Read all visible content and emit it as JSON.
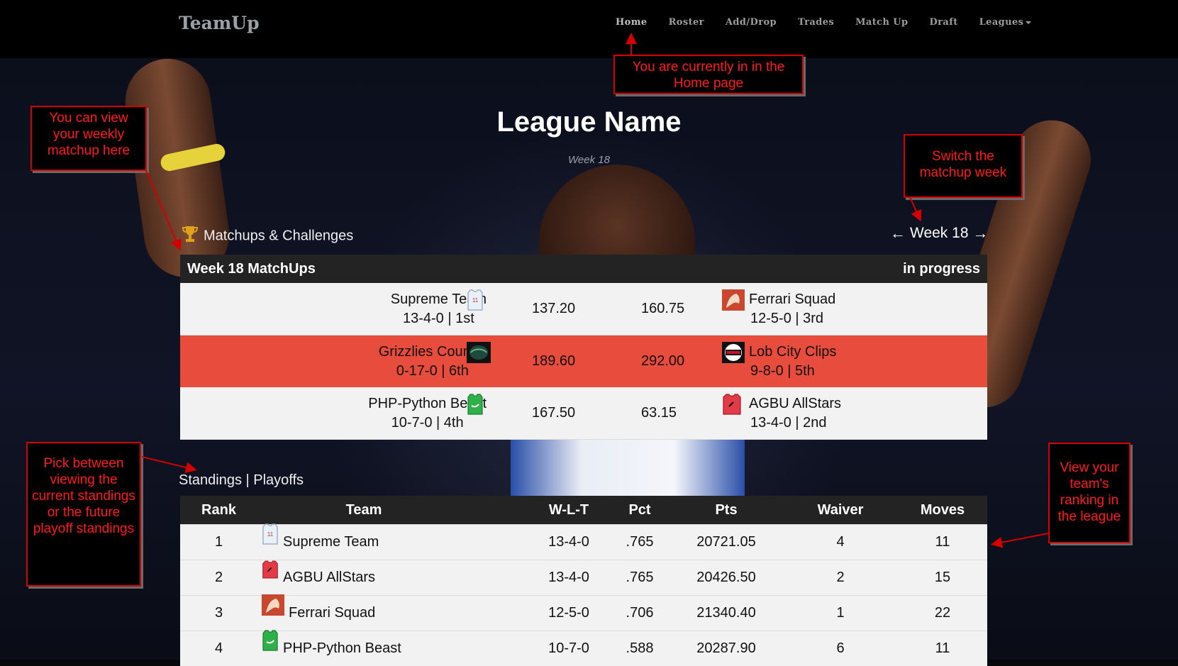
{
  "navbar": {
    "brand": "TeamUp",
    "items": [
      "Home",
      "Roster",
      "Add/Drop",
      "Trades",
      "Match Up",
      "Draft",
      "Leagues"
    ],
    "active": "Home"
  },
  "header": {
    "title": "League Name",
    "subtitle": "Week 18"
  },
  "matchups_section": {
    "label": "Matchups & Challenges",
    "week_switch": "Week 18",
    "table_title": "Week 18 MatchUps",
    "status": "in progress",
    "rows": [
      {
        "left_team": "Supreme Team",
        "left_record": "13-4-0 | 1st",
        "left_score": "137.20",
        "right_score": "160.75",
        "right_team": "Ferrari Squad",
        "right_record": "12-5-0 | 3rd",
        "highlight": false,
        "left_icon": "jersey-white-icon",
        "right_icon": "raptors-icon"
      },
      {
        "left_team": "Grizzlies Country",
        "left_record": "0-17-0 | 6th",
        "left_score": "189.60",
        "right_score": "292.00",
        "right_team": "Lob City Clips",
        "right_record": "9-8-0 | 5th",
        "highlight": true,
        "left_icon": "grizzlies-logo-icon",
        "right_icon": "clippers-logo-icon"
      },
      {
        "left_team": "PHP-Python Beast",
        "left_record": "10-7-0 | 4th",
        "left_score": "167.50",
        "right_score": "63.15",
        "right_team": "AGBU AllStars",
        "right_record": "13-4-0 | 2nd",
        "highlight": false,
        "left_icon": "jersey-green-icon",
        "right_icon": "jersey-red-icon"
      }
    ]
  },
  "standings_section": {
    "label": "Standings | Playoffs",
    "columns": [
      "Rank",
      "Team",
      "W-L-T",
      "Pct",
      "Pts",
      "Waiver",
      "Moves"
    ],
    "rows": [
      {
        "rank": "1",
        "team": "Supreme Team",
        "wlt": "13-4-0",
        "pct": ".765",
        "pts": "20721.05",
        "waiver": "4",
        "moves": "11",
        "icon": "jersey-white-icon"
      },
      {
        "rank": "2",
        "team": "AGBU AllStars",
        "wlt": "13-4-0",
        "pct": ".765",
        "pts": "20426.50",
        "waiver": "2",
        "moves": "15",
        "icon": "jersey-red-icon"
      },
      {
        "rank": "3",
        "team": "Ferrari Squad",
        "wlt": "12-5-0",
        "pct": ".706",
        "pts": "21340.40",
        "waiver": "1",
        "moves": "22",
        "icon": "raptors-icon"
      },
      {
        "rank": "4",
        "team": "PHP-Python Beast",
        "wlt": "10-7-0",
        "pct": ".588",
        "pts": "20287.90",
        "waiver": "6",
        "moves": "11",
        "icon": "jersey-green-icon"
      }
    ]
  },
  "annotations": {
    "home": "You are currently in in the Home page",
    "matchup": "You can view your weekly matchup here",
    "switch": "Switch the matchup week",
    "standings": "Pick between viewing the current standings or the future playoff standings",
    "ranking": "View your team's ranking in the league"
  },
  "colors": {
    "highlight_row": "#e74c3c",
    "table_header": "#232323",
    "annotation_red": "#ff1a1a",
    "navbar": "#000000"
  }
}
